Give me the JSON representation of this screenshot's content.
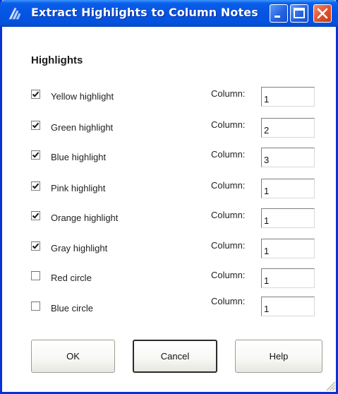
{
  "window": {
    "title": "Extract Highlights to Column Notes",
    "icons": {
      "app": "extract-app-icon",
      "minimize": "minimize-icon",
      "maximize": "maximize-icon",
      "close": "close-icon"
    },
    "colors": {
      "titlebar": "#0554e3",
      "close_button": "#e0502b",
      "frame": "#0831d9"
    }
  },
  "section": {
    "title": "Highlights"
  },
  "rows": [
    {
      "label": "Yellow highlight",
      "checked": true,
      "column_label": "Column:",
      "column_value": "1"
    },
    {
      "label": "Green highlight",
      "checked": true,
      "column_label": "Column:",
      "column_value": "2"
    },
    {
      "label": "Blue highlight",
      "checked": true,
      "column_label": "Column:",
      "column_value": "3"
    },
    {
      "label": "Pink highlight",
      "checked": true,
      "column_label": "Column:",
      "column_value": "1"
    },
    {
      "label": "Orange highlight",
      "checked": true,
      "column_label": "Column:",
      "column_value": "1"
    },
    {
      "label": "Gray highlight",
      "checked": true,
      "column_label": "Column:",
      "column_value": "1"
    },
    {
      "label": "Red circle",
      "checked": false,
      "column_label": "Column:",
      "column_value": "1"
    },
    {
      "label": "Blue circle",
      "checked": false,
      "column_label": "Column:",
      "column_value": "1"
    }
  ],
  "buttons": {
    "ok": "OK",
    "cancel": "Cancel",
    "help": "Help"
  }
}
